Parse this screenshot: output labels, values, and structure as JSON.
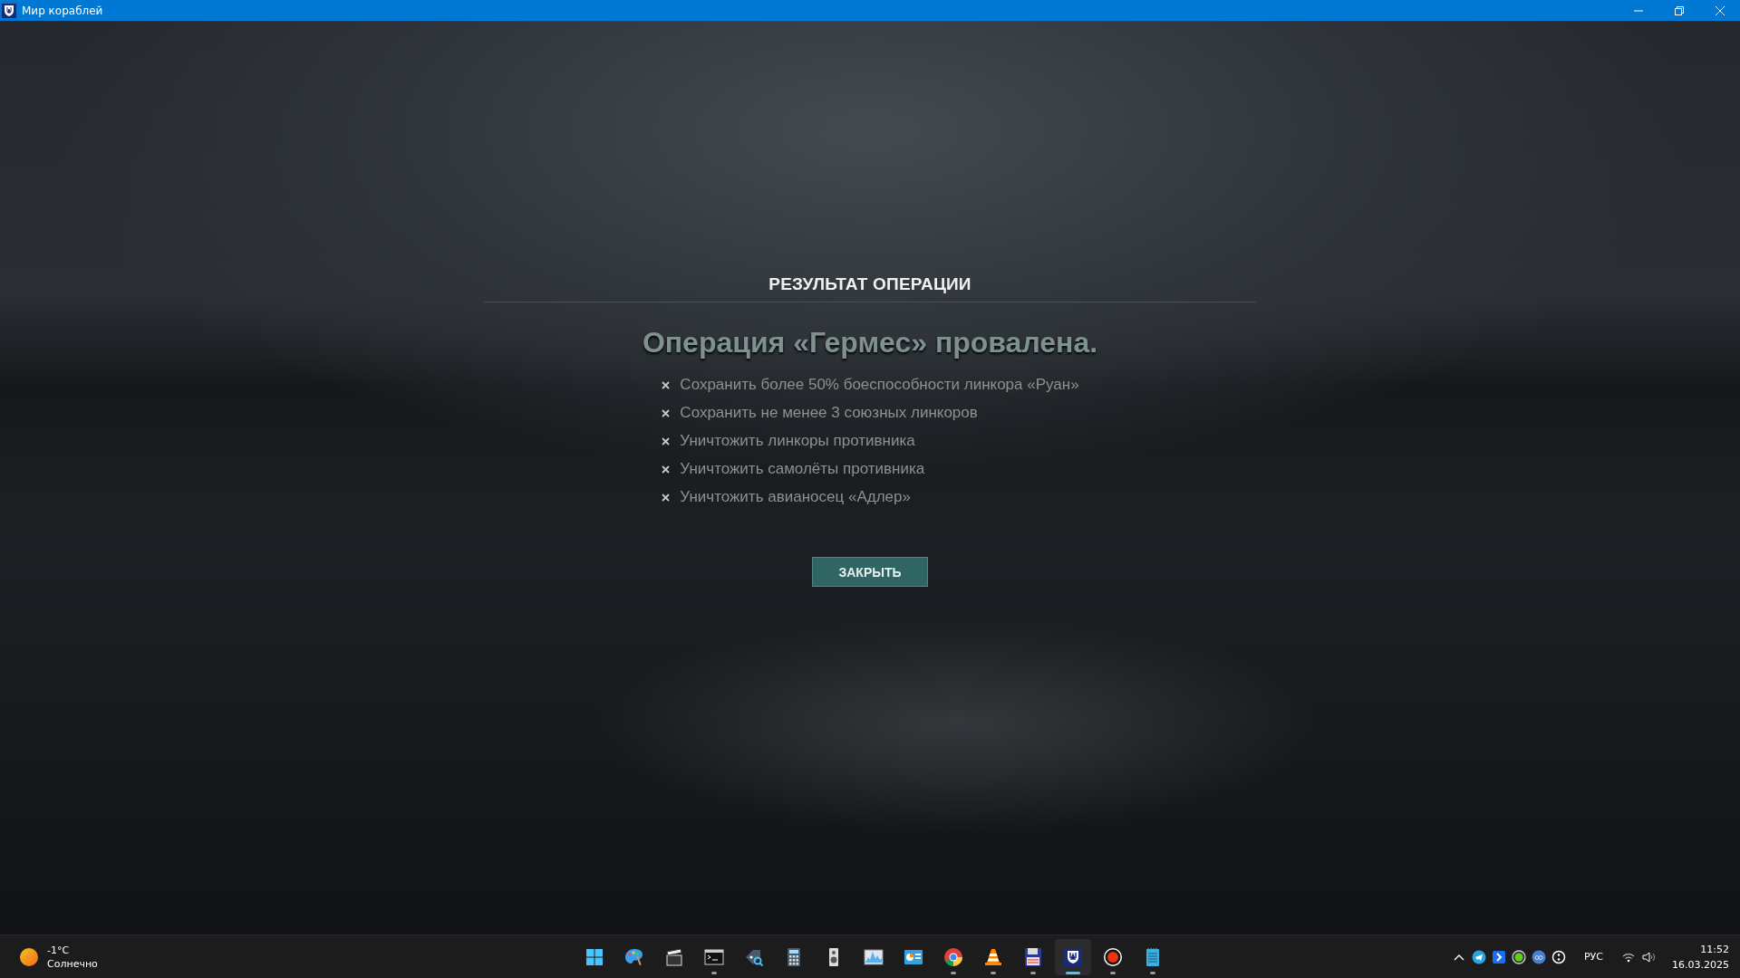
{
  "window": {
    "title": "Мир кораблей"
  },
  "dialog": {
    "header": "РЕЗУЛЬТАТ ОПЕРАЦИИ",
    "result": "Операция «Гермес» провалена.",
    "objectives": [
      {
        "text": "Сохранить более 50% боеспособности линкора «Руан»",
        "completed": false
      },
      {
        "text": "Сохранить не менее 3 союзных линкоров",
        "completed": false
      },
      {
        "text": "Уничтожить линкоры противника",
        "completed": false
      },
      {
        "text": "Уничтожить самолёты противника",
        "completed": false
      },
      {
        "text": "Уничтожить авианосец «Адлер»",
        "completed": false
      }
    ],
    "button": "ЗАКРЫТЬ"
  },
  "taskbar": {
    "weather": {
      "temperature": "-1°C",
      "condition": "Солнечно"
    },
    "apps": [
      {
        "running": false,
        "selected": false
      },
      {
        "running": false,
        "selected": false
      },
      {
        "running": false,
        "selected": false
      },
      {
        "running": true,
        "selected": false
      },
      {
        "running": false,
        "selected": false
      },
      {
        "running": false,
        "selected": false
      },
      {
        "running": false,
        "selected": false
      },
      {
        "running": false,
        "selected": false
      },
      {
        "running": false,
        "selected": false
      },
      {
        "running": true,
        "selected": false
      },
      {
        "running": true,
        "selected": false
      },
      {
        "running": true,
        "selected": false
      },
      {
        "running": true,
        "selected": true
      },
      {
        "running": true,
        "selected": false
      },
      {
        "running": true,
        "selected": false
      }
    ],
    "language": "РУС",
    "time": "11:52",
    "date": "16.03.2025"
  }
}
